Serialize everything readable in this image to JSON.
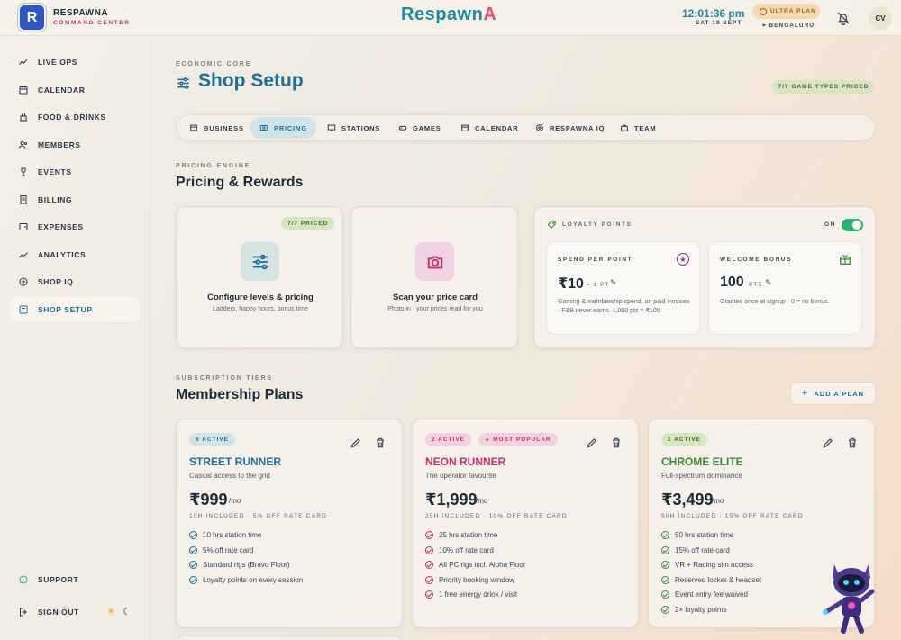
{
  "brand": {
    "logo_letter": "R",
    "name": "RESPAWNA",
    "subtitle": "COMMAND CENTER",
    "wordmark_main": "Respawn",
    "wordmark_accent": "A"
  },
  "header": {
    "time": "12:01:36 pm",
    "date": "SAT 19 SEPT",
    "plan": "ULTRA PLAN",
    "location": "BENGALURU",
    "avatar": "CV"
  },
  "sidebar": {
    "items": [
      {
        "label": "LIVE OPS",
        "icon": "pulse-icon"
      },
      {
        "label": "CALENDAR",
        "icon": "calendar-icon"
      },
      {
        "label": "FOOD & DRINKS",
        "icon": "food-icon"
      },
      {
        "label": "MEMBERS",
        "icon": "members-icon"
      },
      {
        "label": "EVENTS",
        "icon": "trophy-icon"
      },
      {
        "label": "BILLING",
        "icon": "receipt-icon"
      },
      {
        "label": "EXPENSES",
        "icon": "wallet-icon"
      },
      {
        "label": "ANALYTICS",
        "icon": "chart-icon"
      },
      {
        "label": "SHOP IQ",
        "icon": "brain-icon"
      },
      {
        "label": "SHOP SETUP",
        "icon": "sliders-icon",
        "active": true
      }
    ],
    "support": "SUPPORT",
    "sign_out": "SIGN OUT"
  },
  "page": {
    "eyebrow": "ECONOMIC CORE",
    "title": "Shop Setup",
    "types_badge": "7/7 GAME TYPES PRICED"
  },
  "tabs": [
    "BUSINESS",
    "PRICING",
    "STATIONS",
    "GAMES",
    "CALENDAR",
    "RESPAWNA IQ",
    "TEAM"
  ],
  "pricing": {
    "eyebrow": "PRICING ENGINE",
    "title": "Pricing & Rewards",
    "levels_badge": "7/7 PRICED",
    "levels_title": "Configure levels & pricing",
    "levels_sub": "Ladders, happy hours, bonus time",
    "scan_title": "Scan your price card",
    "scan_sub": "Photo in · your prices read for you",
    "loyalty": {
      "label": "LOYALTY POINTS",
      "state": "ON",
      "enabled": true,
      "spend_label": "SPEND PER POINT",
      "spend_value": "₹10",
      "spend_unit": "= 1 PT",
      "spend_desc": "Gaming & membership spend, on paid invoices · F&B never earns. 1,000 pts = ₹100.",
      "welcome_label": "WELCOME BONUS",
      "welcome_value": "100",
      "welcome_unit": "PTS",
      "welcome_desc": "Granted once at signup · 0 = no bonus."
    }
  },
  "membership": {
    "eyebrow": "SUBSCRIPTION TIERS",
    "title": "Membership Plans",
    "add_label": "ADD A PLAN",
    "plans": [
      {
        "active": "0 ACTIVE",
        "name": "STREET RUNNER",
        "tagline": "Casual access to the grid",
        "price": "₹999",
        "period": "/mo",
        "included": "10H INCLUDED · 5% OFF RATE CARD",
        "features": [
          "10 hrs station time",
          "5% off rate card",
          "Standard rigs (Bravo Floor)",
          "Loyalty points on every session"
        ]
      },
      {
        "active": "2 ACTIVE",
        "popular": "MOST POPULAR",
        "name": "NEON RUNNER",
        "tagline": "The operator favourite",
        "price": "₹1,999",
        "period": "/mo",
        "included": "25H INCLUDED · 10% OFF RATE CARD",
        "features": [
          "25 hrs station time",
          "10% off rate card",
          "All PC rigs incl. Alpha Floor",
          "Priority booking window",
          "1 free energy drink / visit"
        ]
      },
      {
        "active": "1 ACTIVE",
        "name": "CHROME ELITE",
        "tagline": "Full-spectrum dominance",
        "price": "₹3,499",
        "period": "/mo",
        "included": "50H INCLUDED · 15% OFF RATE CARD",
        "features": [
          "50 hrs station time",
          "15% off rate card",
          "VR + Racing sim access",
          "Reserved locker & headset",
          "Event entry fee waived",
          "2× loyalty points"
        ]
      }
    ]
  },
  "colors": {
    "accent": "#1f6f98",
    "pink": "#c2306c",
    "green": "#3f8a3a",
    "teal": "#1f8aa4"
  }
}
